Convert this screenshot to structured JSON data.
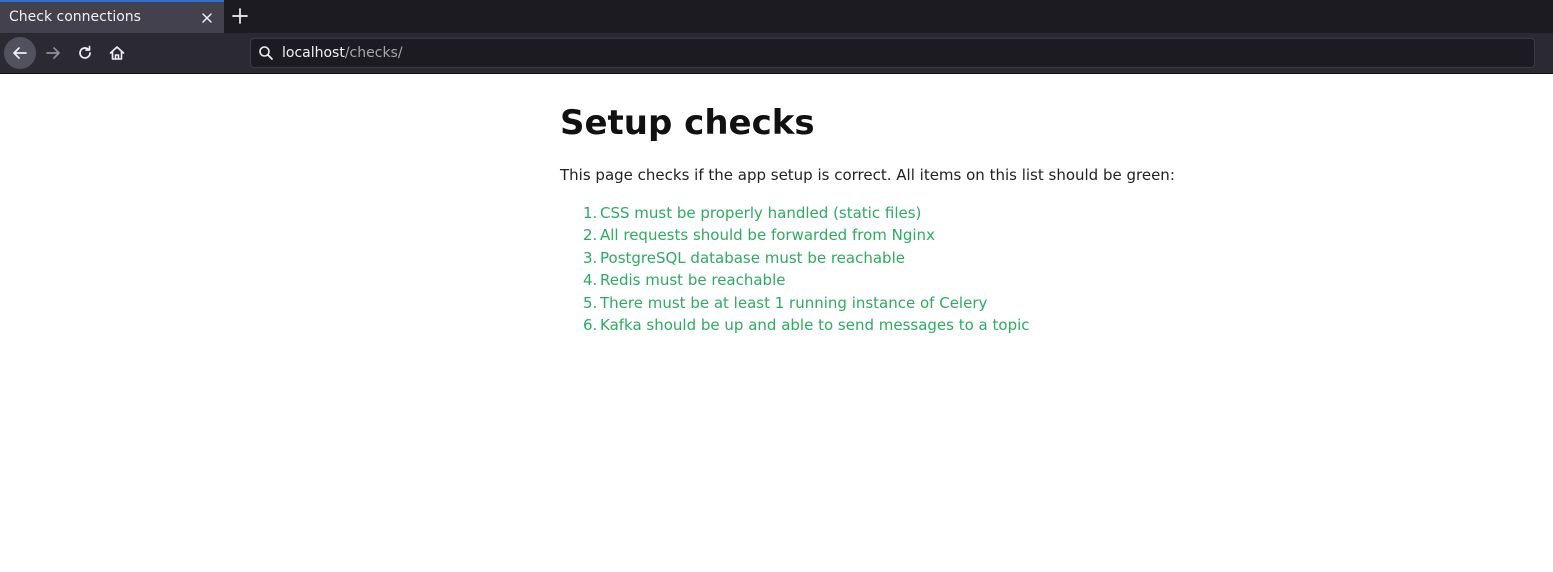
{
  "browser": {
    "tab_title": "Check connections",
    "url_host": "localhost",
    "url_path": "/checks/",
    "icons": [
      "close-icon",
      "plus-icon",
      "back-arrow-icon",
      "forward-arrow-icon",
      "reload-icon",
      "home-icon",
      "search-icon"
    ]
  },
  "page": {
    "title": "Setup checks",
    "intro": "This page checks if the app setup is correct. All items on this list should be green:",
    "status_color": "#2dab62",
    "checks": [
      {
        "num": "1.",
        "text": "CSS must be properly handled (static files)"
      },
      {
        "num": "2.",
        "text": "All requests should be forwarded from Nginx"
      },
      {
        "num": "3.",
        "text": "PostgreSQL database must be reachable"
      },
      {
        "num": "4.",
        "text": "Redis must be reachable"
      },
      {
        "num": "5.",
        "text": "There must be at least 1 running instance of Celery"
      },
      {
        "num": "6.",
        "text": "Kafka should be up and able to send messages to a topic"
      }
    ]
  }
}
